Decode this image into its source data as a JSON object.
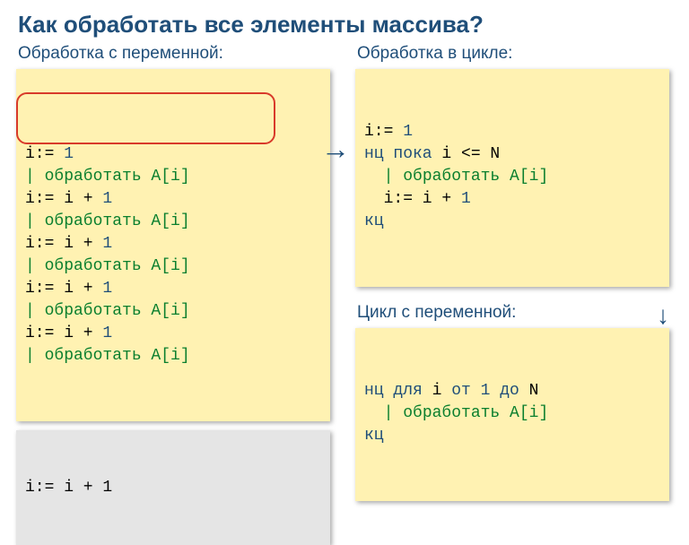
{
  "title": "Как обработать все элементы массива?",
  "left": {
    "heading": "Обработка с переменной:",
    "code_html": "i:= <span class=\"blue\">1</span>\n<span class=\"green\">| обработать A[i]</span>\ni:= i + <span class=\"blue\">1</span>\n<span class=\"green\">| обработать A[i]</span>\ni:= i + <span class=\"blue\">1</span>\n<span class=\"green\">| обработать A[i]</span>\ni:= i + <span class=\"blue\">1</span>\n<span class=\"green\">| обработать A[i]</span>\ni:= i + <span class=\"blue\">1</span>\n<span class=\"green\">| обработать A[i]</span>",
    "graycode_html": "i:= i + <span class=\"blue\">1</span>"
  },
  "rightTop": {
    "heading": "Обработка в цикле:",
    "code_html": "i:= <span class=\"blue\">1</span>\n<span class=\"blue\">нц пока</span> i <= N\n  <span class=\"green\">| обработать A[i]</span>\n  i:= i + <span class=\"blue\">1</span>\n<span class=\"blue\">кц</span>"
  },
  "rightBottom": {
    "heading": "Цикл с переменной:",
    "code_html": "<span class=\"blue\">нц для</span> i <span class=\"blue\">от 1 до</span> N\n  <span class=\"green\">| обработать A[i]</span>\n<span class=\"blue\">кц</span>"
  },
  "arrowRight": "→",
  "arrowDown": "↓"
}
